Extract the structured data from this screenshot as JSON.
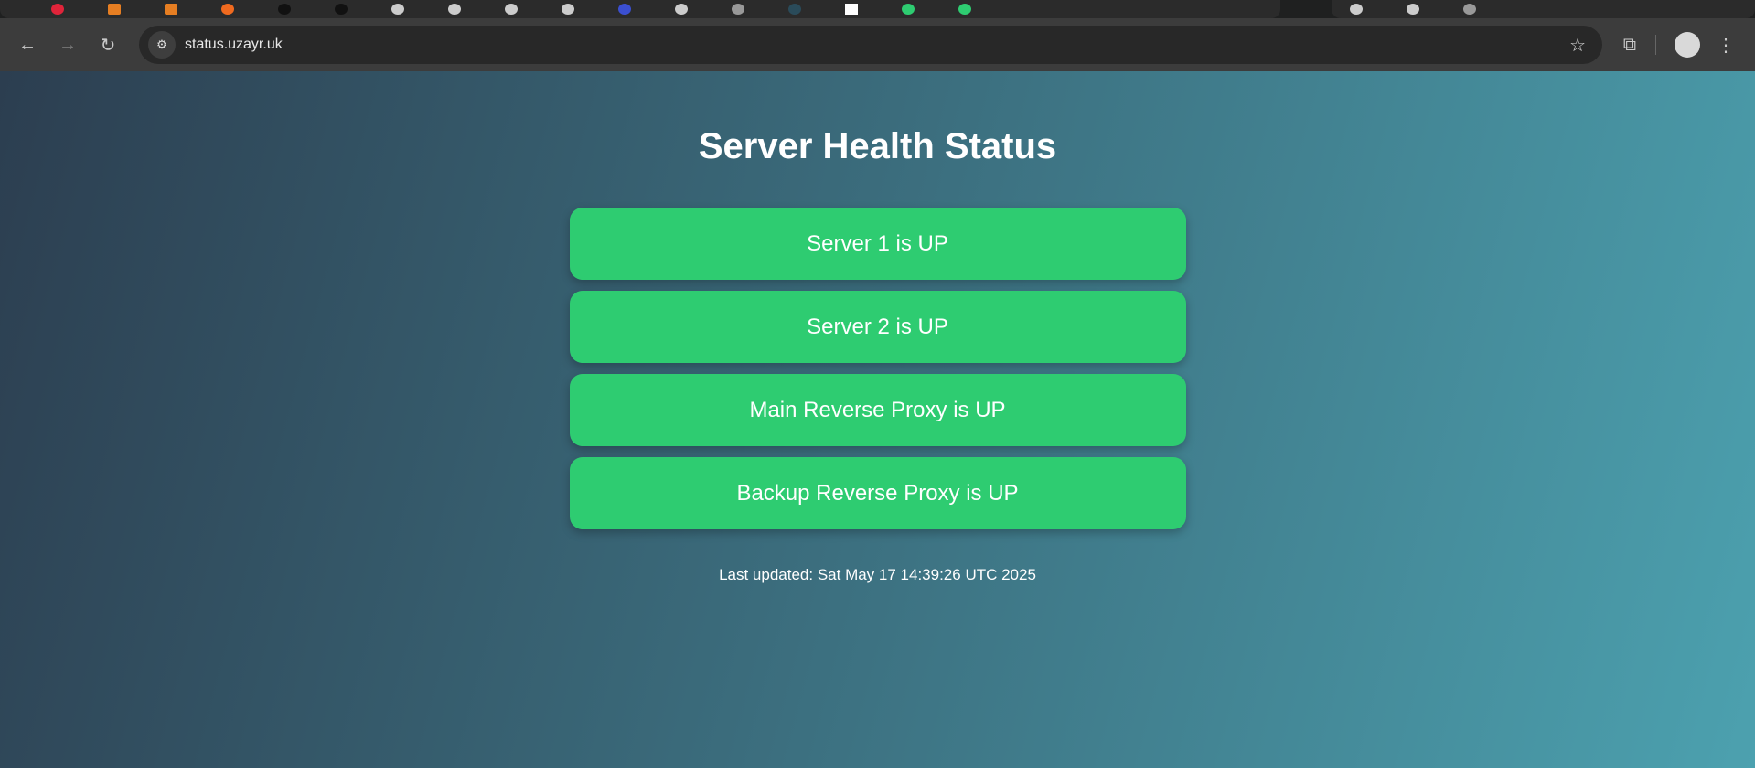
{
  "browser": {
    "url": "status.uzayr.uk",
    "icons": {
      "back": "arrow-left-icon",
      "forward": "arrow-right-icon",
      "reload": "reload-icon",
      "site_info": "tune-icon",
      "bookmark": "star-icon",
      "extensions": "puzzle-icon",
      "menu": "kebab-menu-icon"
    }
  },
  "page": {
    "title": "Server Health Status",
    "servers": [
      {
        "label": "Server 1 is UP",
        "status": "up"
      },
      {
        "label": "Server 2 is UP",
        "status": "up"
      },
      {
        "label": "Main Reverse Proxy is UP",
        "status": "up"
      },
      {
        "label": "Backup Reverse Proxy is UP",
        "status": "up"
      }
    ],
    "last_updated": "Last updated: Sat May 17 14:39:26 UTC 2025",
    "colors": {
      "up": "#2ecc71",
      "gradient_start": "#2c3e50",
      "gradient_end": "#4ca1af"
    }
  }
}
